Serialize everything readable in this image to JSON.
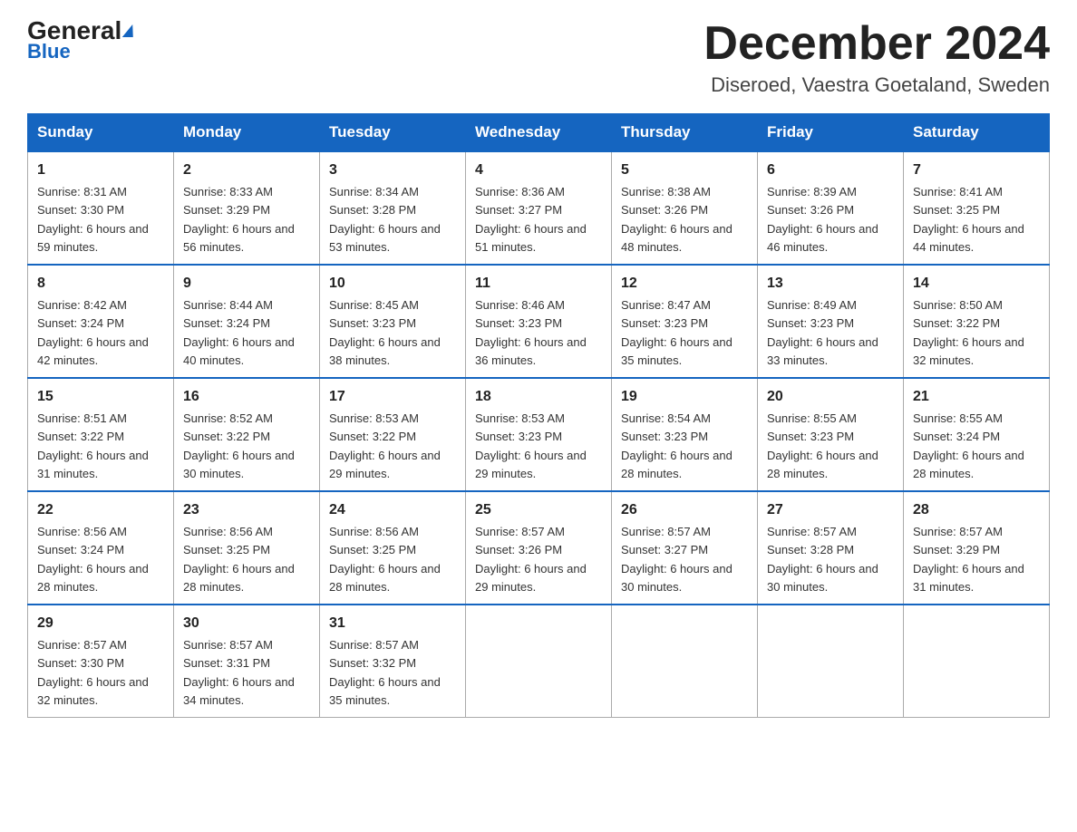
{
  "header": {
    "logo_general": "General",
    "logo_blue": "Blue",
    "month_title": "December 2024",
    "location": "Diseroed, Vaestra Goetaland, Sweden"
  },
  "weekdays": [
    "Sunday",
    "Monday",
    "Tuesday",
    "Wednesday",
    "Thursday",
    "Friday",
    "Saturday"
  ],
  "weeks": [
    [
      {
        "day": "1",
        "sunrise": "8:31 AM",
        "sunset": "3:30 PM",
        "daylight": "6 hours and 59 minutes."
      },
      {
        "day": "2",
        "sunrise": "8:33 AM",
        "sunset": "3:29 PM",
        "daylight": "6 hours and 56 minutes."
      },
      {
        "day": "3",
        "sunrise": "8:34 AM",
        "sunset": "3:28 PM",
        "daylight": "6 hours and 53 minutes."
      },
      {
        "day": "4",
        "sunrise": "8:36 AM",
        "sunset": "3:27 PM",
        "daylight": "6 hours and 51 minutes."
      },
      {
        "day": "5",
        "sunrise": "8:38 AM",
        "sunset": "3:26 PM",
        "daylight": "6 hours and 48 minutes."
      },
      {
        "day": "6",
        "sunrise": "8:39 AM",
        "sunset": "3:26 PM",
        "daylight": "6 hours and 46 minutes."
      },
      {
        "day": "7",
        "sunrise": "8:41 AM",
        "sunset": "3:25 PM",
        "daylight": "6 hours and 44 minutes."
      }
    ],
    [
      {
        "day": "8",
        "sunrise": "8:42 AM",
        "sunset": "3:24 PM",
        "daylight": "6 hours and 42 minutes."
      },
      {
        "day": "9",
        "sunrise": "8:44 AM",
        "sunset": "3:24 PM",
        "daylight": "6 hours and 40 minutes."
      },
      {
        "day": "10",
        "sunrise": "8:45 AM",
        "sunset": "3:23 PM",
        "daylight": "6 hours and 38 minutes."
      },
      {
        "day": "11",
        "sunrise": "8:46 AM",
        "sunset": "3:23 PM",
        "daylight": "6 hours and 36 minutes."
      },
      {
        "day": "12",
        "sunrise": "8:47 AM",
        "sunset": "3:23 PM",
        "daylight": "6 hours and 35 minutes."
      },
      {
        "day": "13",
        "sunrise": "8:49 AM",
        "sunset": "3:23 PM",
        "daylight": "6 hours and 33 minutes."
      },
      {
        "day": "14",
        "sunrise": "8:50 AM",
        "sunset": "3:22 PM",
        "daylight": "6 hours and 32 minutes."
      }
    ],
    [
      {
        "day": "15",
        "sunrise": "8:51 AM",
        "sunset": "3:22 PM",
        "daylight": "6 hours and 31 minutes."
      },
      {
        "day": "16",
        "sunrise": "8:52 AM",
        "sunset": "3:22 PM",
        "daylight": "6 hours and 30 minutes."
      },
      {
        "day": "17",
        "sunrise": "8:53 AM",
        "sunset": "3:22 PM",
        "daylight": "6 hours and 29 minutes."
      },
      {
        "day": "18",
        "sunrise": "8:53 AM",
        "sunset": "3:23 PM",
        "daylight": "6 hours and 29 minutes."
      },
      {
        "day": "19",
        "sunrise": "8:54 AM",
        "sunset": "3:23 PM",
        "daylight": "6 hours and 28 minutes."
      },
      {
        "day": "20",
        "sunrise": "8:55 AM",
        "sunset": "3:23 PM",
        "daylight": "6 hours and 28 minutes."
      },
      {
        "day": "21",
        "sunrise": "8:55 AM",
        "sunset": "3:24 PM",
        "daylight": "6 hours and 28 minutes."
      }
    ],
    [
      {
        "day": "22",
        "sunrise": "8:56 AM",
        "sunset": "3:24 PM",
        "daylight": "6 hours and 28 minutes."
      },
      {
        "day": "23",
        "sunrise": "8:56 AM",
        "sunset": "3:25 PM",
        "daylight": "6 hours and 28 minutes."
      },
      {
        "day": "24",
        "sunrise": "8:56 AM",
        "sunset": "3:25 PM",
        "daylight": "6 hours and 28 minutes."
      },
      {
        "day": "25",
        "sunrise": "8:57 AM",
        "sunset": "3:26 PM",
        "daylight": "6 hours and 29 minutes."
      },
      {
        "day": "26",
        "sunrise": "8:57 AM",
        "sunset": "3:27 PM",
        "daylight": "6 hours and 30 minutes."
      },
      {
        "day": "27",
        "sunrise": "8:57 AM",
        "sunset": "3:28 PM",
        "daylight": "6 hours and 30 minutes."
      },
      {
        "day": "28",
        "sunrise": "8:57 AM",
        "sunset": "3:29 PM",
        "daylight": "6 hours and 31 minutes."
      }
    ],
    [
      {
        "day": "29",
        "sunrise": "8:57 AM",
        "sunset": "3:30 PM",
        "daylight": "6 hours and 32 minutes."
      },
      {
        "day": "30",
        "sunrise": "8:57 AM",
        "sunset": "3:31 PM",
        "daylight": "6 hours and 34 minutes."
      },
      {
        "day": "31",
        "sunrise": "8:57 AM",
        "sunset": "3:32 PM",
        "daylight": "6 hours and 35 minutes."
      },
      null,
      null,
      null,
      null
    ]
  ]
}
